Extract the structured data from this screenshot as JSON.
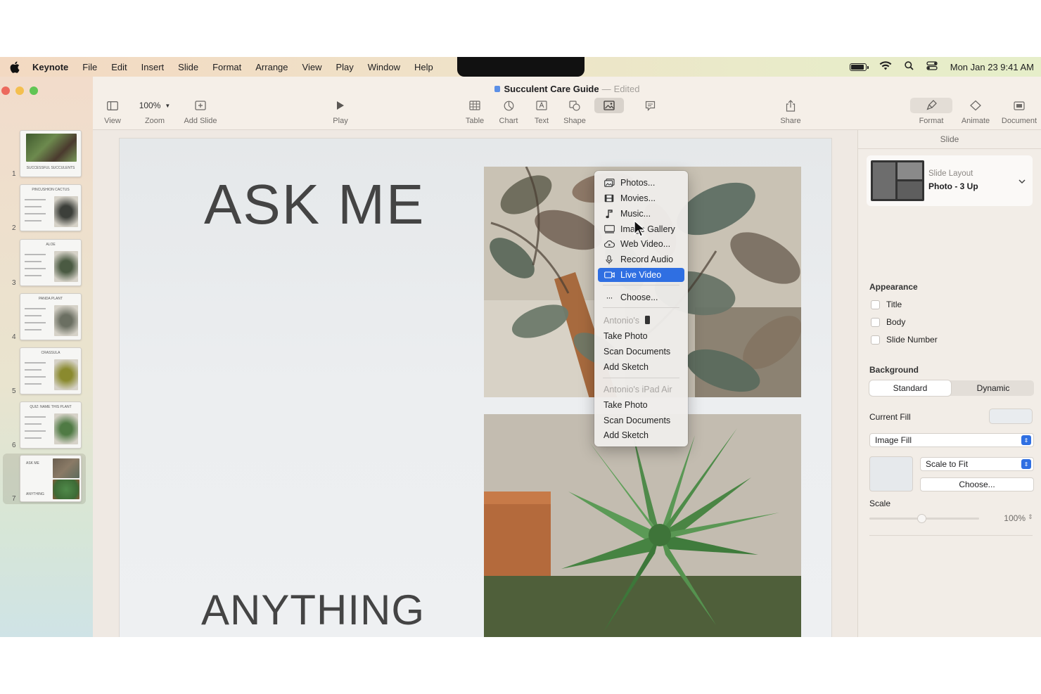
{
  "menubar": {
    "app": "Keynote",
    "items": [
      "File",
      "Edit",
      "Insert",
      "Slide",
      "Format",
      "Arrange",
      "View",
      "Play",
      "Window",
      "Help"
    ],
    "clock": "Mon Jan 23  9:41 AM",
    "status_icons": [
      "battery-icon",
      "wifi-icon",
      "search-icon",
      "control-center-icon"
    ]
  },
  "window": {
    "title": "Succulent Care Guide",
    "separator": "—",
    "edited": "Edited"
  },
  "toolbar": {
    "view": "View",
    "zoom_value": "100%",
    "zoom": "Zoom",
    "add_slide": "Add Slide",
    "play": "Play",
    "table": "Table",
    "chart": "Chart",
    "text": "Text",
    "shape": "Shape",
    "share": "Share",
    "format": "Format",
    "animate": "Animate",
    "document": "Document"
  },
  "navigator": {
    "slides": [
      {
        "number": "1",
        "title": "SUCCESSFUL SUCCULENTS"
      },
      {
        "number": "2",
        "title": "PINCUSHION CACTUS"
      },
      {
        "number": "3",
        "title": "ALOE"
      },
      {
        "number": "4",
        "title": "PANDA PLANT"
      },
      {
        "number": "5",
        "title": "CRASSULA"
      },
      {
        "number": "6",
        "title": "QUIZ: NAME THIS PLANT"
      },
      {
        "number": "7",
        "title": "ASK ME",
        "subtitle": "ANYTHING"
      }
    ],
    "selected_index": 6
  },
  "slide": {
    "heading_top": "ASK ME",
    "heading_bottom": "ANYTHING"
  },
  "media_menu": {
    "items": [
      {
        "label": "Photos...",
        "icon": "photos-icon"
      },
      {
        "label": "Movies...",
        "icon": "film-icon"
      },
      {
        "label": "Music...",
        "icon": "music-note-icon"
      },
      {
        "label": "Image Gallery",
        "icon": "image-gallery-icon"
      },
      {
        "label": "Web Video...",
        "icon": "web-video-icon"
      },
      {
        "label": "Record Audio",
        "icon": "microphone-icon"
      },
      {
        "label": "Live Video",
        "icon": "live-video-icon",
        "highlighted": true
      },
      {
        "label": "Choose...",
        "icon": "ellipsis-icon"
      }
    ],
    "device1": {
      "header": "Antonio's",
      "items": [
        "Take Photo",
        "Scan Documents",
        "Add Sketch"
      ]
    },
    "device2": {
      "header": "Antonio's iPad Air",
      "items": [
        "Take Photo",
        "Scan Documents",
        "Add Sketch"
      ]
    }
  },
  "inspector": {
    "tab": "Slide",
    "slide_layout_label": "Slide Layout",
    "slide_layout_value": "Photo - 3 Up",
    "appearance": "Appearance",
    "checkboxes": [
      "Title",
      "Body",
      "Slide Number"
    ],
    "background": "Background",
    "bg_options": [
      "Standard",
      "Dynamic"
    ],
    "current_fill": "Current Fill",
    "fill_type": "Image Fill",
    "scale_mode": "Scale to Fit",
    "choose": "Choose...",
    "scale_label": "Scale",
    "scale_value": "100%"
  },
  "colors": {
    "accent": "#2f6fe2",
    "close": "#ec6a5e",
    "minimize": "#f4bf4f",
    "zoom": "#61c554"
  }
}
